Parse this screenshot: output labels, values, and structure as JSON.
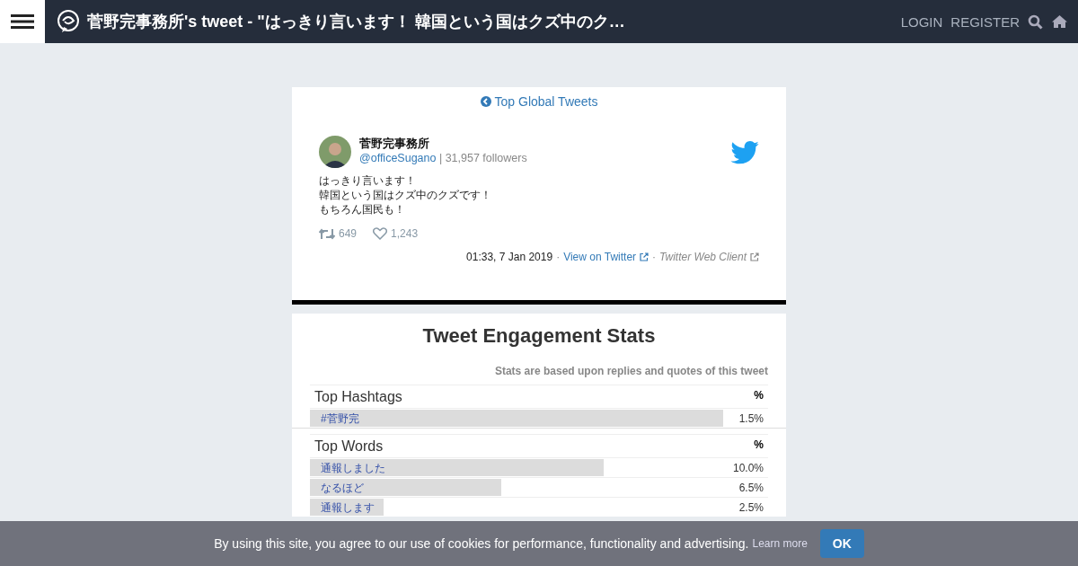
{
  "header": {
    "title": "菅野完事務所's tweet - \"はっきり言います！ 韓国という国はクズ中のク…",
    "nav": [
      "LOGIN",
      "REGISTER"
    ]
  },
  "tweet": {
    "back_link": "Top Global Tweets",
    "author": "菅野完事務所",
    "handle": "@officeSugano",
    "followers": "| 31,957 followers",
    "lines": [
      "はっきり言います！",
      "韓国という国はクズ中のクズです！",
      "もちろん国民も！"
    ],
    "separators": [
      "·",
      "·"
    ],
    "retweets": "649",
    "likes": "1,243",
    "time": "01:33, 7 Jan 2019",
    "view_link": "View on Twitter",
    "client": "Twitter Web Client"
  },
  "stats": {
    "title": "Tweet Engagement Stats",
    "note": "Stats are based upon replies and quotes of this tweet",
    "sections": [
      {
        "heading": "Top Hashtags",
        "col": "%",
        "rows": [
          {
            "label": "#菅野完",
            "value": "1.5%",
            "level": 1.0
          }
        ]
      },
      {
        "heading": "Top Words",
        "col": "%",
        "rows": [
          {
            "label": "通報しました",
            "value": "10.0%",
            "level": 0.71
          },
          {
            "label": "なるほど",
            "value": "6.5%",
            "level": 0.463
          },
          {
            "label": "通報します",
            "value": "2.5%",
            "level": 0.178
          }
        ]
      }
    ]
  },
  "cookie": {
    "text": "By using this site, you agree to our use of cookies for performance, functionality and advertising.",
    "link": "Learn more",
    "button": "OK"
  }
}
